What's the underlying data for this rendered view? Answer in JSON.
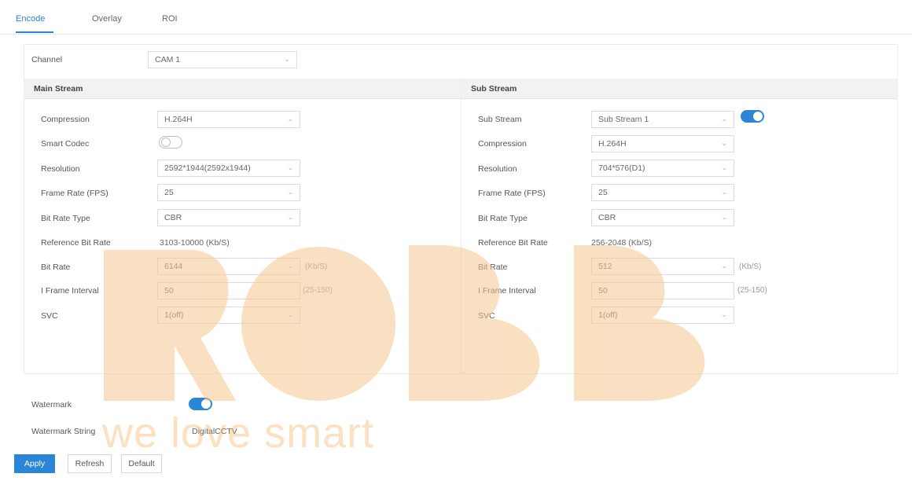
{
  "tabs": [
    {
      "label": "Encode",
      "active": true
    },
    {
      "label": "Overlay",
      "active": false
    },
    {
      "label": "ROI",
      "active": false
    }
  ],
  "channel": {
    "label": "Channel",
    "value": "CAM 1"
  },
  "main_stream": {
    "header": "Main Stream",
    "compression_label": "Compression",
    "compression_value": "H.264H",
    "smart_codec_label": "Smart Codec",
    "smart_codec_on": false,
    "resolution_label": "Resolution",
    "resolution_value": "2592*1944(2592x1944)",
    "frame_rate_label": "Frame Rate (FPS)",
    "frame_rate_value": "25",
    "bit_rate_type_label": "Bit Rate Type",
    "bit_rate_type_value": "CBR",
    "ref_bit_rate_label": "Reference Bit Rate",
    "ref_bit_rate_value": "3103-10000 (Kb/S)",
    "bit_rate_label": "Bit Rate",
    "bit_rate_value": "6144",
    "bit_rate_unit": "(Kb/S)",
    "iframe_label": "I Frame Interval",
    "iframe_value": "50",
    "iframe_range": "(25-150)",
    "svc_label": "SVC",
    "svc_value": "1(off)"
  },
  "sub_stream": {
    "header": "Sub Stream",
    "sub_stream_label": "Sub Stream",
    "sub_stream_value": "Sub Stream 1",
    "sub_stream_on": true,
    "compression_label": "Compression",
    "compression_value": "H.264H",
    "resolution_label": "Resolution",
    "resolution_value": "704*576(D1)",
    "frame_rate_label": "Frame Rate (FPS)",
    "frame_rate_value": "25",
    "bit_rate_type_label": "Bit Rate Type",
    "bit_rate_type_value": "CBR",
    "ref_bit_rate_label": "Reference Bit Rate",
    "ref_bit_rate_value": "256-2048 (Kb/S)",
    "bit_rate_label": "Bit Rate",
    "bit_rate_value": "512",
    "bit_rate_unit": "(Kb/S)",
    "iframe_label": "I Frame Interval",
    "iframe_value": "50",
    "iframe_range": "(25-150)",
    "svc_label": "SVC",
    "svc_value": "1(off)"
  },
  "watermark": {
    "label": "Watermark",
    "on": true,
    "string_label": "Watermark String",
    "string_value": "DigitalCCTV"
  },
  "buttons": {
    "apply": "Apply",
    "refresh": "Refresh",
    "default": "Default"
  },
  "overlay_logo": {
    "text": "we love smart"
  },
  "colors": {
    "accent": "#2b86d6",
    "watermark_logo": "#f5c78f"
  }
}
